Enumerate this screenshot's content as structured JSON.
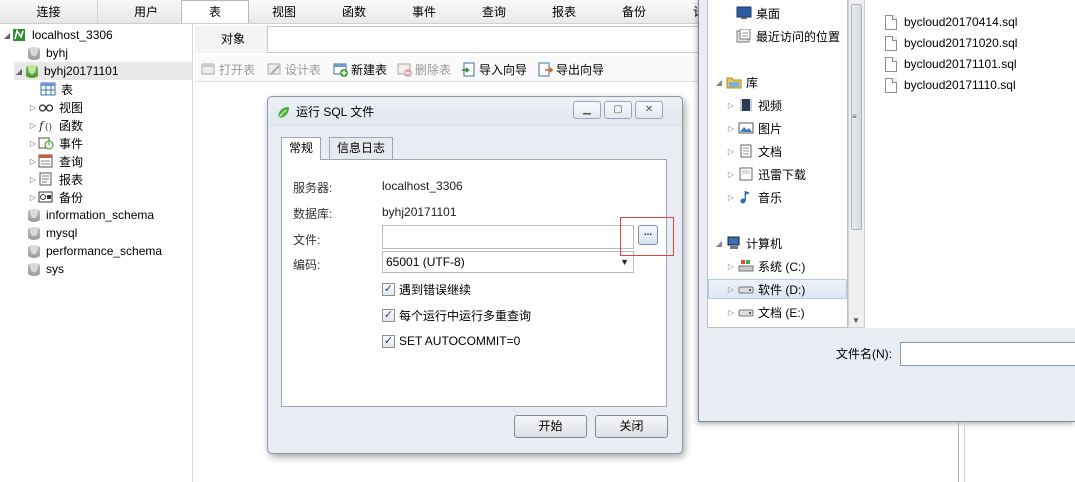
{
  "left_tabs": [
    "连接",
    "用户"
  ],
  "menu": {
    "items": [
      "表",
      "视图",
      "函数",
      "事件",
      "查询",
      "报表",
      "备份",
      "计"
    ],
    "active": "表"
  },
  "tree": {
    "connection": "localhost_3306",
    "databases": [
      {
        "name": "byhj",
        "open": false
      },
      {
        "name": "byhj20171101",
        "open": true,
        "selected": true,
        "children": [
          "表",
          "视图",
          "函数",
          "事件",
          "查询",
          "报表",
          "备份"
        ]
      },
      {
        "name": "information_schema"
      },
      {
        "name": "mysql"
      },
      {
        "name": "performance_schema"
      },
      {
        "name": "sys"
      }
    ]
  },
  "object_bar": {
    "label": "对象"
  },
  "toolbar": {
    "open_table": "打开表",
    "design_table": "设计表",
    "new_table": "新建表",
    "delete_table": "删除表",
    "import_wizard": "导入向导",
    "export_wizard": "导出向导"
  },
  "dialog": {
    "title": "运行 SQL 文件",
    "tabs": [
      "常规",
      "信息日志"
    ],
    "active_tab": "常规",
    "server_label": "服务器:",
    "server_value": "localhost_3306",
    "database_label": "数据库:",
    "database_value": "byhj20171101",
    "file_label": "文件:",
    "file_value": "",
    "browse_label": "...",
    "encoding_label": "编码:",
    "encoding_value": "65001 (UTF-8)",
    "options": [
      {
        "label": "遇到错误继续",
        "checked": true
      },
      {
        "label": "每个运行中运行多重查询",
        "checked": true
      },
      {
        "label": "SET AUTOCOMMIT=0",
        "checked": true
      }
    ],
    "start_button": "开始",
    "close_button": "关闭"
  },
  "file_dialog": {
    "nav": {
      "desktop": "桌面",
      "recent": "最近访问的位置",
      "libraries": "库",
      "videos": "视频",
      "pictures": "图片",
      "documents": "文档",
      "thunder": "迅雷下载",
      "music": "音乐",
      "computer": "计算机",
      "drive_c": "系统 (C:)",
      "drive_d": "软件 (D:)",
      "drive_e": "文档 (E:)"
    },
    "files": [
      "bycloud20170414.sql",
      "bycloud20171020.sql",
      "bycloud20171101.sql",
      "bycloud20171110.sql"
    ],
    "filename_label": "文件名(N):",
    "filename_value": ""
  }
}
